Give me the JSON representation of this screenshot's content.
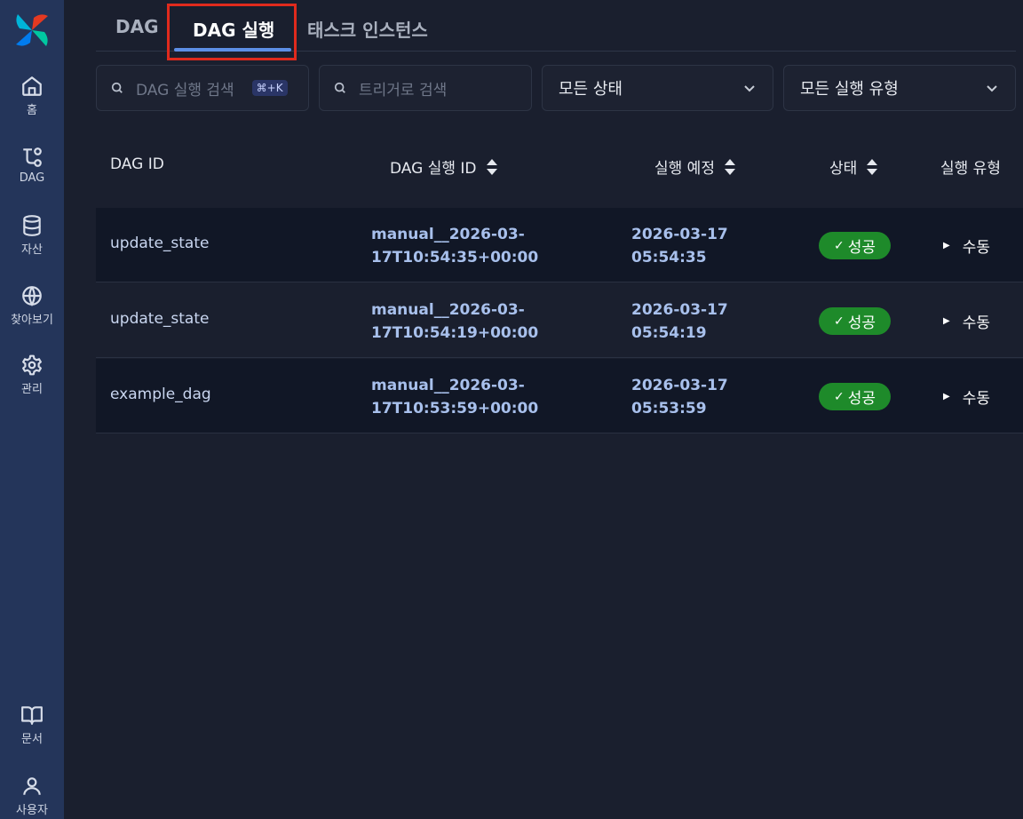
{
  "sidebar": {
    "items": [
      {
        "label": "홈",
        "icon": "home-icon"
      },
      {
        "label": "DAG",
        "icon": "dag-icon"
      },
      {
        "label": "자산",
        "icon": "database-icon"
      },
      {
        "label": "찾아보기",
        "icon": "globe-icon"
      },
      {
        "label": "관리",
        "icon": "gear-icon"
      }
    ],
    "bottom": [
      {
        "label": "문서",
        "icon": "book-icon"
      },
      {
        "label": "사용자",
        "icon": "user-icon"
      }
    ]
  },
  "tabs": [
    {
      "label": "DAG"
    },
    {
      "label": "DAG 실행",
      "active": true
    },
    {
      "label": "태스크 인스턴스"
    }
  ],
  "filters": {
    "dag_search_placeholder": "DAG 실행 검색",
    "dag_search_shortcut": "⌘+K",
    "trigger_search_placeholder": "트리거로 검색",
    "state_select": "모든 상태",
    "run_type_select": "모든 실행 유형"
  },
  "table": {
    "headers": [
      "DAG ID",
      "DAG 실행 ID",
      "실행 예정",
      "상태",
      "실행 유형"
    ],
    "rows": [
      {
        "dag_id": "update_state",
        "run_id_1": "manual__2026-03-",
        "run_id_2": "17T10:54:35+00:00",
        "sched_1": "2026-03-17",
        "sched_2": "05:54:35",
        "state": "성공",
        "run_type": "수동"
      },
      {
        "dag_id": "update_state",
        "run_id_1": "manual__2026-03-",
        "run_id_2": "17T10:54:19+00:00",
        "sched_1": "2026-03-17",
        "sched_2": "05:54:19",
        "state": "성공",
        "run_type": "수동"
      },
      {
        "dag_id": "example_dag",
        "run_id_1": "manual__2026-03-",
        "run_id_2": "17T10:53:59+00:00",
        "sched_1": "2026-03-17",
        "sched_2": "05:53:59",
        "state": "성공",
        "run_type": "수동"
      }
    ]
  },
  "colors": {
    "background": "#1a1f2e",
    "sidebar": "#24355a",
    "accent": "#5c8ee6",
    "success": "#1e8a2a",
    "highlight": "#e02a1d"
  }
}
